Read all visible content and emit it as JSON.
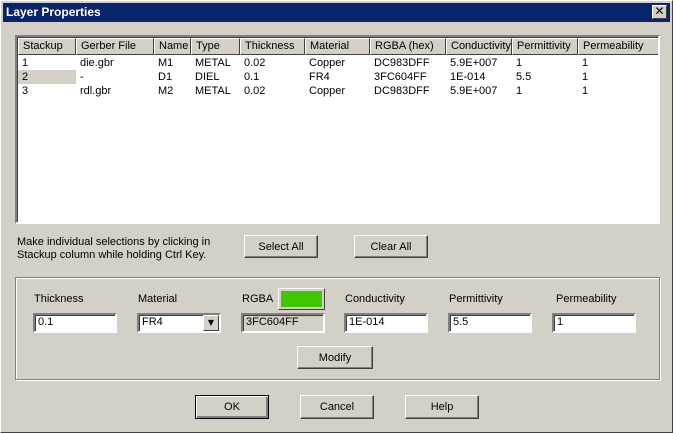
{
  "window": {
    "title": "Layer Properties",
    "close_glyph": "✕"
  },
  "table": {
    "columns": [
      "Stackup",
      "Gerber File",
      "Name",
      "Type",
      "Thickness",
      "Material",
      "RGBA (hex)",
      "Conductivity",
      "Permittivity",
      "Permeability"
    ],
    "rows": [
      [
        "1",
        "die.gbr",
        "M1",
        "METAL",
        "0.02",
        "Copper",
        "DC983DFF",
        "5.9E+007",
        "1",
        "1"
      ],
      [
        "2",
        "-",
        "D1",
        "DIEL",
        "0.1",
        "FR4",
        "3FC604FF",
        "1E-014",
        "5.5",
        "1"
      ],
      [
        "3",
        "rdl.gbr",
        "M2",
        "METAL",
        "0.02",
        "Copper",
        "DC983DFF",
        "5.9E+007",
        "1",
        "1"
      ]
    ],
    "selected_row": 1
  },
  "hint": "Make individual selections by clicking in Stackup column while holding Ctrl Key.",
  "buttons": {
    "select_all": "Select All",
    "clear_all": "Clear All",
    "modify": "Modify",
    "ok": "OK",
    "cancel": "Cancel",
    "help": "Help"
  },
  "editor": {
    "thickness_label": "Thickness",
    "thickness_value": "0.1",
    "material_label": "Material",
    "material_value": "FR4",
    "rgba_label": "RGBA",
    "rgba_value": "3FC604FF",
    "rgba_color": "#3fc604",
    "conductivity_label": "Conductivity",
    "conductivity_value": "1E-014",
    "permittivity_label": "Permittivity",
    "permittivity_value": "5.5",
    "permeability_label": "Permeability",
    "permeability_value": "1"
  },
  "icons": {
    "close": "close-icon",
    "dropdown": "chevron-down-icon"
  }
}
